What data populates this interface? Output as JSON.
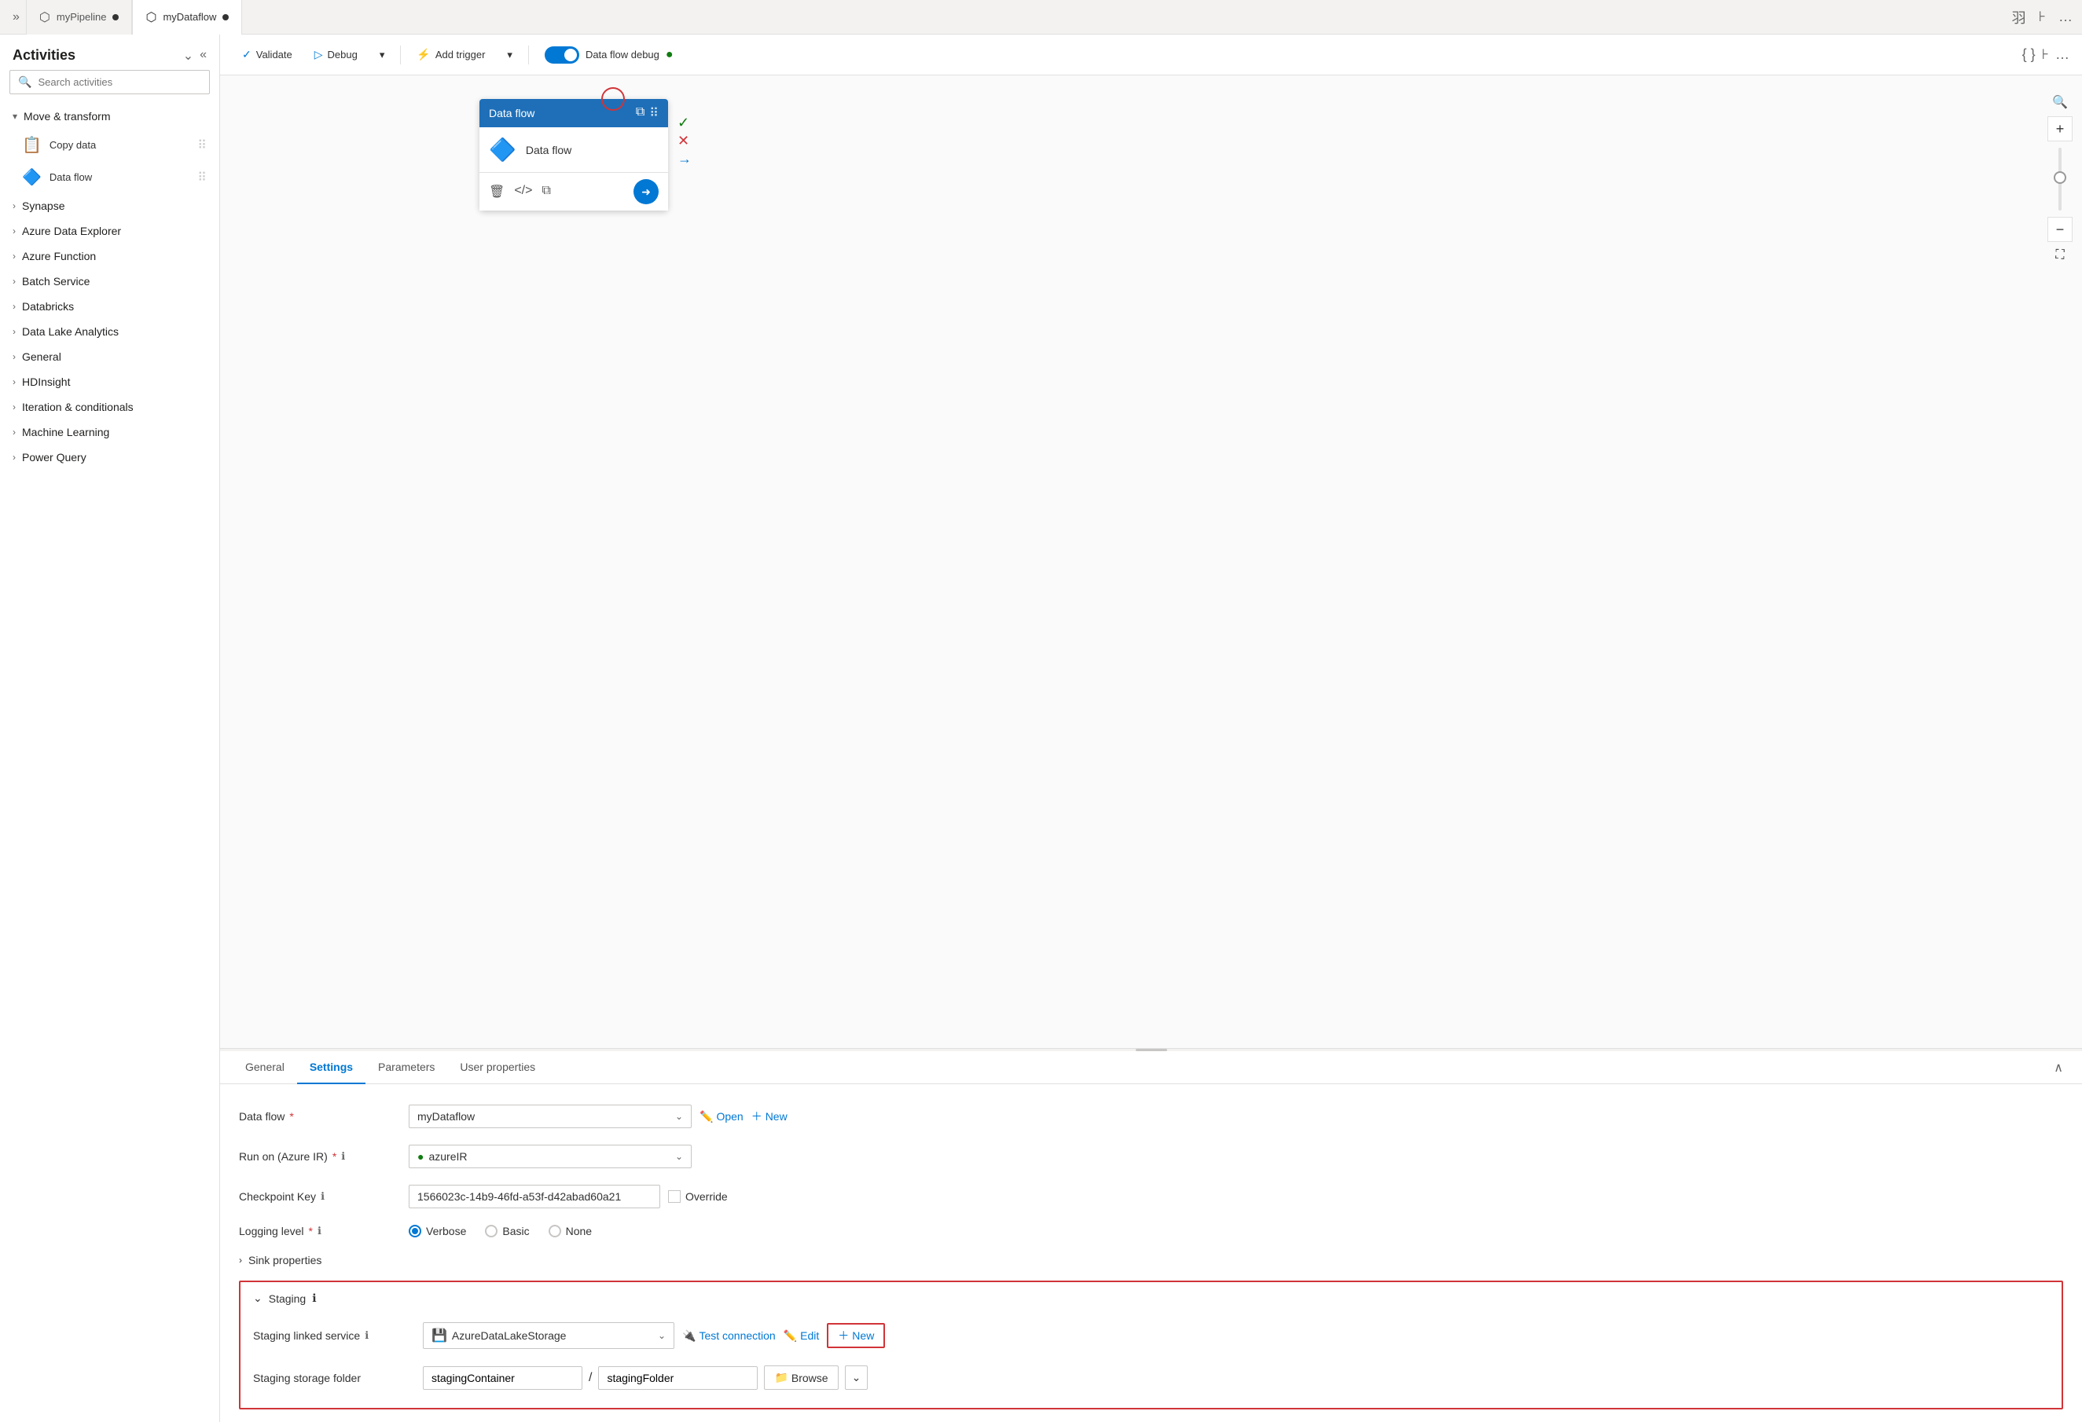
{
  "tabs": [
    {
      "id": "pipeline",
      "label": "myPipeline",
      "icon": "⬡",
      "dot": true,
      "active": false
    },
    {
      "id": "dataflow",
      "label": "myDataflow",
      "icon": "⬡",
      "dot": true,
      "active": true
    }
  ],
  "sidebar": {
    "title": "Activities",
    "search_placeholder": "Search activities",
    "categories": [
      {
        "label": "Move & transform",
        "expanded": true,
        "items": [
          {
            "label": "Copy data",
            "icon": "📋"
          },
          {
            "label": "Data flow",
            "icon": "🔷"
          }
        ]
      },
      {
        "label": "Synapse",
        "expanded": false,
        "items": []
      },
      {
        "label": "Azure Data Explorer",
        "expanded": false,
        "items": []
      },
      {
        "label": "Azure Function",
        "expanded": false,
        "items": []
      },
      {
        "label": "Batch Service",
        "expanded": false,
        "items": []
      },
      {
        "label": "Databricks",
        "expanded": false,
        "items": []
      },
      {
        "label": "Data Lake Analytics",
        "expanded": false,
        "items": []
      },
      {
        "label": "General",
        "expanded": false,
        "items": []
      },
      {
        "label": "HDInsight",
        "expanded": false,
        "items": []
      },
      {
        "label": "Iteration & conditionals",
        "expanded": false,
        "items": []
      },
      {
        "label": "Machine Learning",
        "expanded": false,
        "items": []
      },
      {
        "label": "Power Query",
        "expanded": false,
        "items": []
      }
    ]
  },
  "toolbar": {
    "validate_label": "Validate",
    "debug_label": "Debug",
    "add_trigger_label": "Add trigger",
    "debug_toggle_label": "Data flow debug",
    "debug_toggle_on": true,
    "debug_status": "●"
  },
  "node": {
    "title": "Data flow",
    "body_label": "Data flow"
  },
  "settings_tabs": [
    {
      "id": "general",
      "label": "General",
      "active": false
    },
    {
      "id": "settings",
      "label": "Settings",
      "active": true
    },
    {
      "id": "parameters",
      "label": "Parameters",
      "active": false
    },
    {
      "id": "user_properties",
      "label": "User properties",
      "active": false
    }
  ],
  "settings": {
    "data_flow_label": "Data flow",
    "data_flow_required": true,
    "data_flow_value": "myDataflow",
    "data_flow_open": "Open",
    "data_flow_new": "New",
    "run_on_label": "Run on (Azure IR)",
    "run_on_required": true,
    "run_on_value": "azureIR",
    "checkpoint_key_label": "Checkpoint Key",
    "checkpoint_key_value": "1566023c-14b9-46fd-a53f-d42abad60a21",
    "override_label": "Override",
    "logging_level_label": "Logging level",
    "logging_required": true,
    "logging_options": [
      {
        "label": "Verbose",
        "selected": true
      },
      {
        "label": "Basic",
        "selected": false
      },
      {
        "label": "None",
        "selected": false
      }
    ],
    "sink_properties_label": "Sink properties",
    "staging_label": "Staging",
    "staging_linked_service_label": "Staging linked service",
    "staging_linked_service_value": "AzureDataLakeStorage",
    "test_connection_label": "Test connection",
    "edit_label": "Edit",
    "new_label": "New",
    "staging_storage_folder_label": "Staging storage folder",
    "staging_container_value": "stagingContainer",
    "staging_folder_value": "stagingFolder",
    "browse_label": "Browse"
  },
  "zoom": {
    "plus": "+",
    "minus": "−"
  }
}
